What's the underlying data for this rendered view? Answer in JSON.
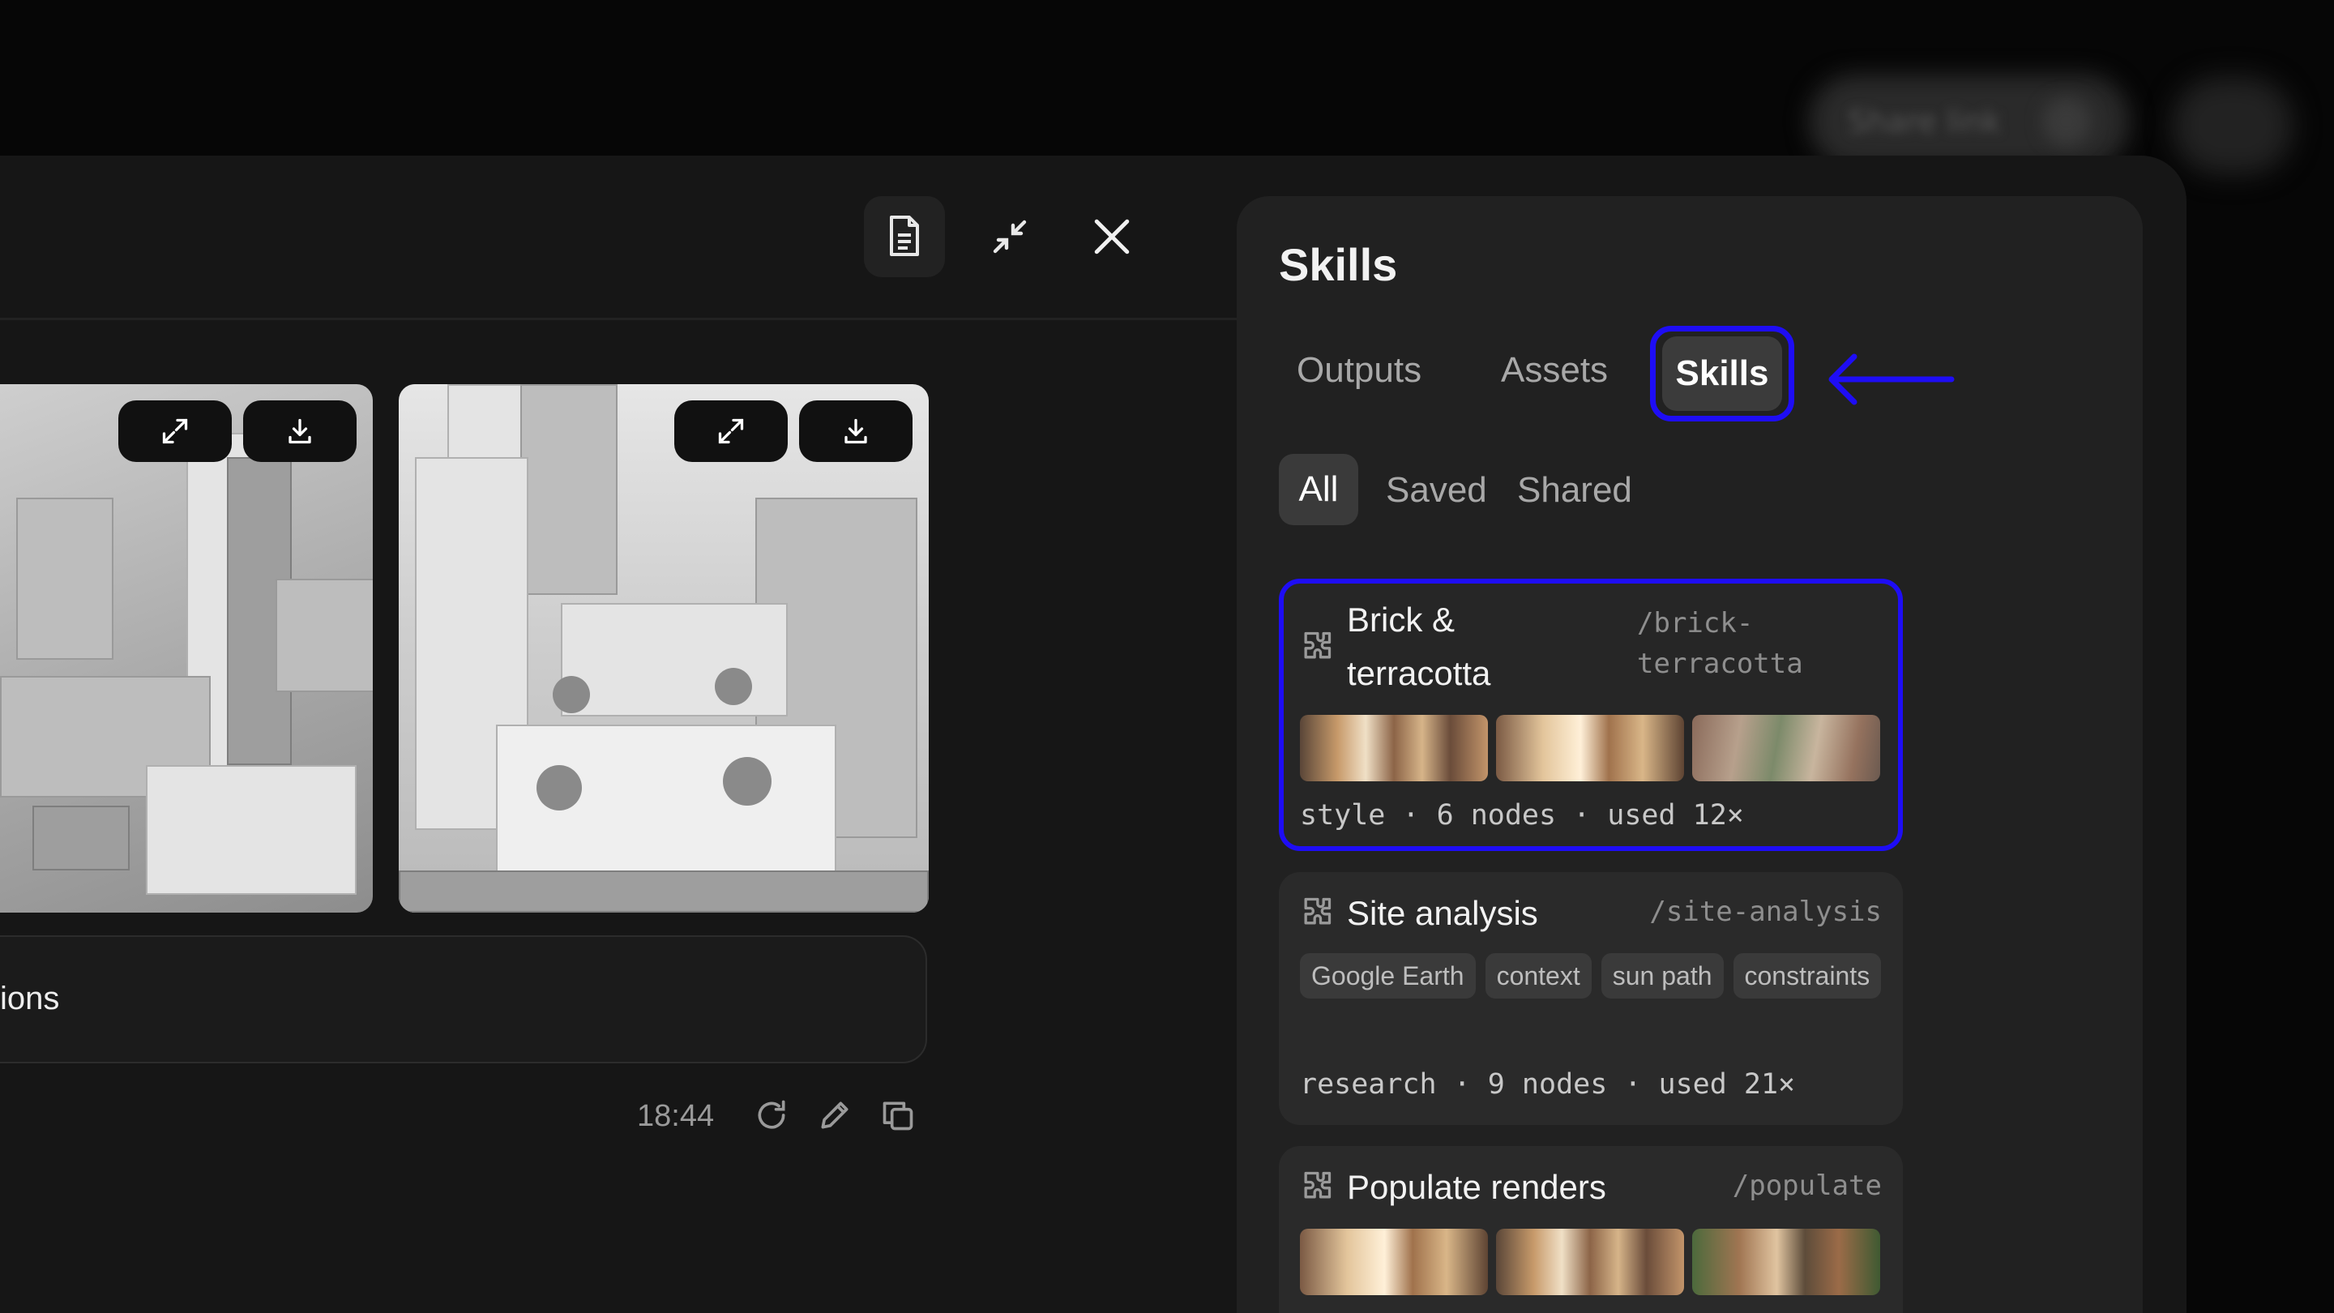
{
  "backdrop": {
    "pill_label": "Share link"
  },
  "header": {
    "doc_icon": "document-icon",
    "collapse_icon": "collapse-icon",
    "close_icon": "close-icon"
  },
  "images": [
    {
      "expand_icon": "expand-icon",
      "download_icon": "download-icon"
    },
    {
      "expand_icon": "expand-icon",
      "download_icon": "download-icon"
    }
  ],
  "input": {
    "text": "ions"
  },
  "message": {
    "time": "18:44",
    "actions": [
      "refresh-icon",
      "edit-icon",
      "copy-icon"
    ]
  },
  "panel": {
    "title": "Skills",
    "tabs": [
      {
        "label": "Outputs",
        "active": false
      },
      {
        "label": "Assets",
        "active": false
      },
      {
        "label": "Skills",
        "active": true
      }
    ],
    "filters": [
      {
        "label": "All",
        "active": true
      },
      {
        "label": "Saved",
        "active": false
      },
      {
        "label": "Shared",
        "active": false
      }
    ],
    "skills": [
      {
        "name_line1": "Brick &",
        "name_line2": "terracotta",
        "slug_line1": "/brick-",
        "slug_line2": "terracotta",
        "meta": "style · 6 nodes · used 12×",
        "selected": true
      },
      {
        "name": "Site analysis",
        "slug": "/site-analysis",
        "tags": [
          "Google Earth",
          "context",
          "sun path",
          "constraints"
        ],
        "meta": "research · 9 nodes · used 21×",
        "selected": false
      },
      {
        "name": "Populate renders",
        "slug": "/populate",
        "selected": false
      }
    ]
  },
  "colors": {
    "highlight": "#1e0df5",
    "panel": "#212121",
    "surface": "#161616"
  }
}
